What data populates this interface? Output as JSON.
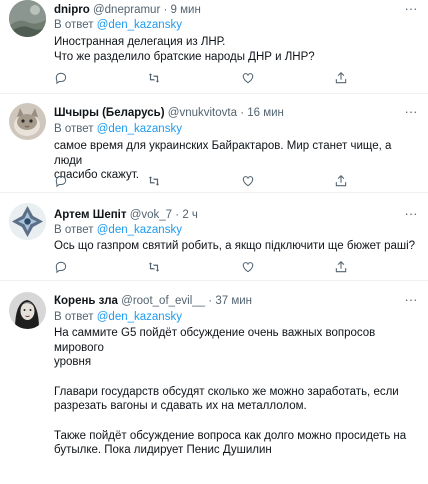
{
  "reply_prefix": "В ответ",
  "tweets": [
    {
      "name": "dnipro",
      "handle": "@dnepramur",
      "dot": "·",
      "time": "9 мин",
      "reply_to": "@den_kazansky",
      "lines": [
        "Иностранная делегация из ЛНР.",
        "Что же разделило братские народы ДНР и ЛНР?"
      ]
    },
    {
      "name": "Шчыры (Беларусь)",
      "handle": "@vnukvitovta",
      "dot": "·",
      "time": "16 мин",
      "reply_to": "@den_kazansky",
      "lines": [
        "самое время для украинских Байрактаров. Мир станет чище, а люди",
        "спасибо скажут."
      ]
    },
    {
      "name": "Артем Шепіт",
      "handle": "@vok_7",
      "dot": "·",
      "time": "2 ч",
      "reply_to": "@den_kazansky",
      "lines": [
        "Ось що газпром святий робить, а якщо підключити ще бюжет раші?"
      ]
    },
    {
      "name": "Корень зла",
      "handle": "@root_of_evil__",
      "dot": "·",
      "time": "37 мин",
      "reply_to": "@den_kazansky",
      "lines": [
        "На саммите G5 пойдёт обсуждение очень важных вопросов мирового",
        "уровня"
      ],
      "lines2": [
        "Главари государств обсудят сколько же можно заработать, если",
        "разрезать вагоны и сдавать их на металлолом."
      ],
      "lines3": [
        "Также пойдёт обсуждение вопроса как долго можно просидеть на",
        "бутылке. Пока лидирует Пенис Душилин"
      ]
    }
  ],
  "icons": [
    "more-icon",
    "reply-icon",
    "retweet-icon",
    "like-icon",
    "share-icon"
  ],
  "colors": {
    "text": "#0f1419",
    "secondary": "#536471",
    "link": "#1d9bf0",
    "divider": "#eff3f4"
  }
}
